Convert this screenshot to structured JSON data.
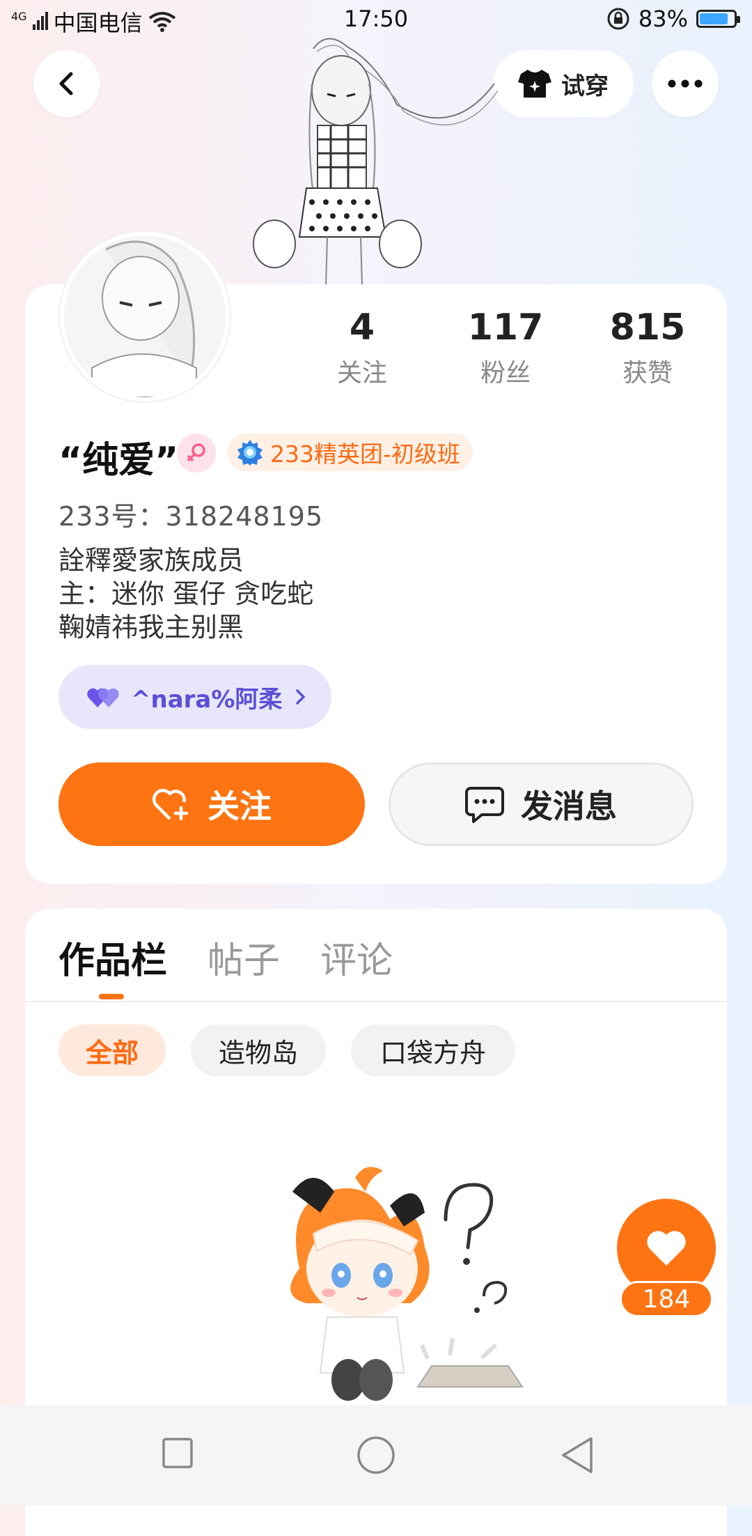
{
  "status_bar": {
    "network": "4G",
    "carrier": "中国电信",
    "time": "17:50",
    "battery_percent": "83%",
    "battery_level": 0.83
  },
  "top_bar": {
    "try_on_label": "试穿"
  },
  "profile": {
    "stats": [
      {
        "value": "4",
        "label": "关注"
      },
      {
        "value": "117",
        "label": "粉丝"
      },
      {
        "value": "815",
        "label": "获赞"
      }
    ],
    "name": "“纯爱”",
    "badge": "233精英团-初级班",
    "uid": "233号：318248195",
    "bio_lines": [
      "詮釋愛家族成员",
      "主：迷你 蛋仔 贪吃蛇",
      "鞠婧祎我主别黑"
    ],
    "family_tag": "^nara%阿柔",
    "follow_label": "关注",
    "message_label": "发消息"
  },
  "tabs": [
    {
      "label": "作品栏",
      "active": true
    },
    {
      "label": "帖子",
      "active": false
    },
    {
      "label": "评论",
      "active": false
    }
  ],
  "filters": [
    {
      "label": "全部",
      "active": true
    },
    {
      "label": "造物岛",
      "active": false
    },
    {
      "label": "口袋方舟",
      "active": false
    }
  ],
  "like_fab": {
    "count": "184"
  },
  "colors": {
    "accent": "#ff7412",
    "family_purple": "#5b4fd8"
  }
}
